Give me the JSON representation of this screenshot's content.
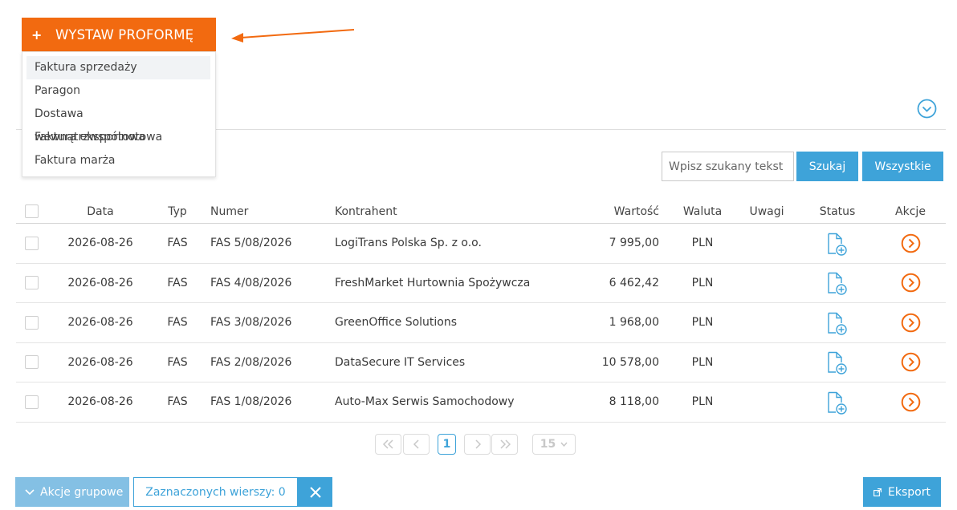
{
  "issue_button": {
    "plus": "+",
    "label": "WYSTAW PROFORMĘ"
  },
  "menu": {
    "items": [
      {
        "label": "Faktura sprzedaży"
      },
      {
        "label": "Paragon"
      },
      {
        "label": "Dostawa wewnątrzwspólnotowa"
      },
      {
        "label": "Faktura eksportowa"
      },
      {
        "label": "Faktura marża"
      }
    ]
  },
  "search": {
    "placeholder": "Wpisz szukany tekst",
    "search_label": "Szukaj",
    "all_label": "Wszystkie"
  },
  "table": {
    "headers": {
      "date": "Data",
      "type": "Typ",
      "number": "Numer",
      "contractor": "Kontrahent",
      "value": "Wartość",
      "currency": "Waluta",
      "remarks": "Uwagi",
      "status": "Status",
      "actions": "Akcje"
    },
    "rows": [
      {
        "date": "2026-08-26",
        "type": "FAS",
        "number": "FAS 5/08/2026",
        "contractor": "LogiTrans Polska Sp. z o.o.",
        "value": "7 995,00",
        "currency": "PLN",
        "remarks": ""
      },
      {
        "date": "2026-08-26",
        "type": "FAS",
        "number": "FAS 4/08/2026",
        "contractor": "FreshMarket Hurtownia Spożywcza",
        "value": "6 462,42",
        "currency": "PLN",
        "remarks": ""
      },
      {
        "date": "2026-08-26",
        "type": "FAS",
        "number": "FAS 3/08/2026",
        "contractor": "GreenOffice Solutions",
        "value": "1 968,00",
        "currency": "PLN",
        "remarks": ""
      },
      {
        "date": "2026-08-26",
        "type": "FAS",
        "number": "FAS 2/08/2026",
        "contractor": "DataSecure IT Services",
        "value": "10 578,00",
        "currency": "PLN",
        "remarks": ""
      },
      {
        "date": "2026-08-26",
        "type": "FAS",
        "number": "FAS 1/08/2026",
        "contractor": "Auto-Max Serwis Samochodowy",
        "value": "8 118,00",
        "currency": "PLN",
        "remarks": ""
      }
    ]
  },
  "pagination": {
    "current_page": "1",
    "page_size": "15"
  },
  "footer": {
    "group_actions_label": "Akcje grupowe",
    "selected_rows_label": "Zaznaczonych wierszy: 0",
    "export_label": "Eksport"
  },
  "colors": {
    "accent_orange": "#f26a10",
    "accent_blue": "#3ea3d9"
  },
  "icons": {
    "status": "document-plus-icon",
    "action": "circle-chevron-right-icon",
    "expand": "circle-chevron-down-icon",
    "export": "external-link-icon",
    "clear": "close-icon"
  }
}
